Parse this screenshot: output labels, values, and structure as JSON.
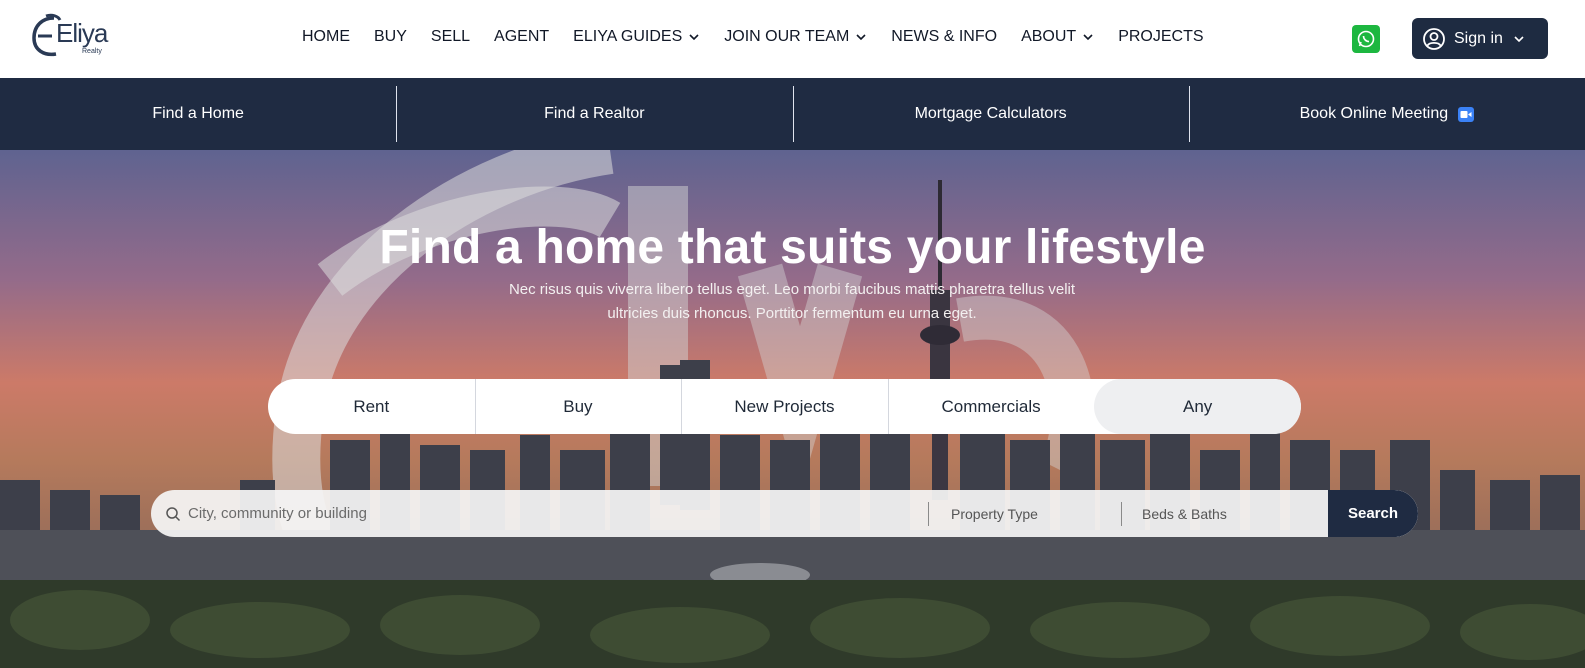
{
  "brand": {
    "name": "Eliya",
    "sub": "Realty"
  },
  "nav": [
    {
      "label": "HOME",
      "dropdown": false
    },
    {
      "label": "BUY",
      "dropdown": false
    },
    {
      "label": "SELL",
      "dropdown": false
    },
    {
      "label": "AGENT",
      "dropdown": false
    },
    {
      "label": "ELIYA GUIDES",
      "dropdown": true
    },
    {
      "label": "JOIN OUR TEAM",
      "dropdown": true
    },
    {
      "label": "NEWS & INFO",
      "dropdown": false
    },
    {
      "label": "ABOUT",
      "dropdown": true
    },
    {
      "label": "PROJECTS",
      "dropdown": false
    }
  ],
  "header": {
    "whatsapp_icon": "whatsapp-icon",
    "signin_label": "Sign in"
  },
  "subbar": [
    {
      "label": "Find a Home"
    },
    {
      "label": "Find a Realtor"
    },
    {
      "label": "Mortgage Calculators"
    },
    {
      "label": "Book Online Meeting",
      "icon": "video-camera-icon"
    }
  ],
  "hero": {
    "title": "Find a home that suits your lifestyle",
    "subtitle": "Nec risus quis viverra libero tellus eget. Leo morbi faucibus mattis pharetra tellus velit ultricies duis rhoncus. Porttitor fermentum eu urna eget."
  },
  "tabs": [
    {
      "label": "Rent",
      "active": false
    },
    {
      "label": "Buy",
      "active": false
    },
    {
      "label": "New Projects",
      "active": false
    },
    {
      "label": "Commercials",
      "active": false
    },
    {
      "label": "Any",
      "active": true
    }
  ],
  "search": {
    "placeholder": "City, community or building",
    "property_type": "Property Type",
    "beds_baths": "Beds & Baths",
    "button": "Search"
  },
  "colors": {
    "navy": "#1f2b42",
    "whatsapp": "#1db740",
    "camera": "#3b82f6"
  }
}
